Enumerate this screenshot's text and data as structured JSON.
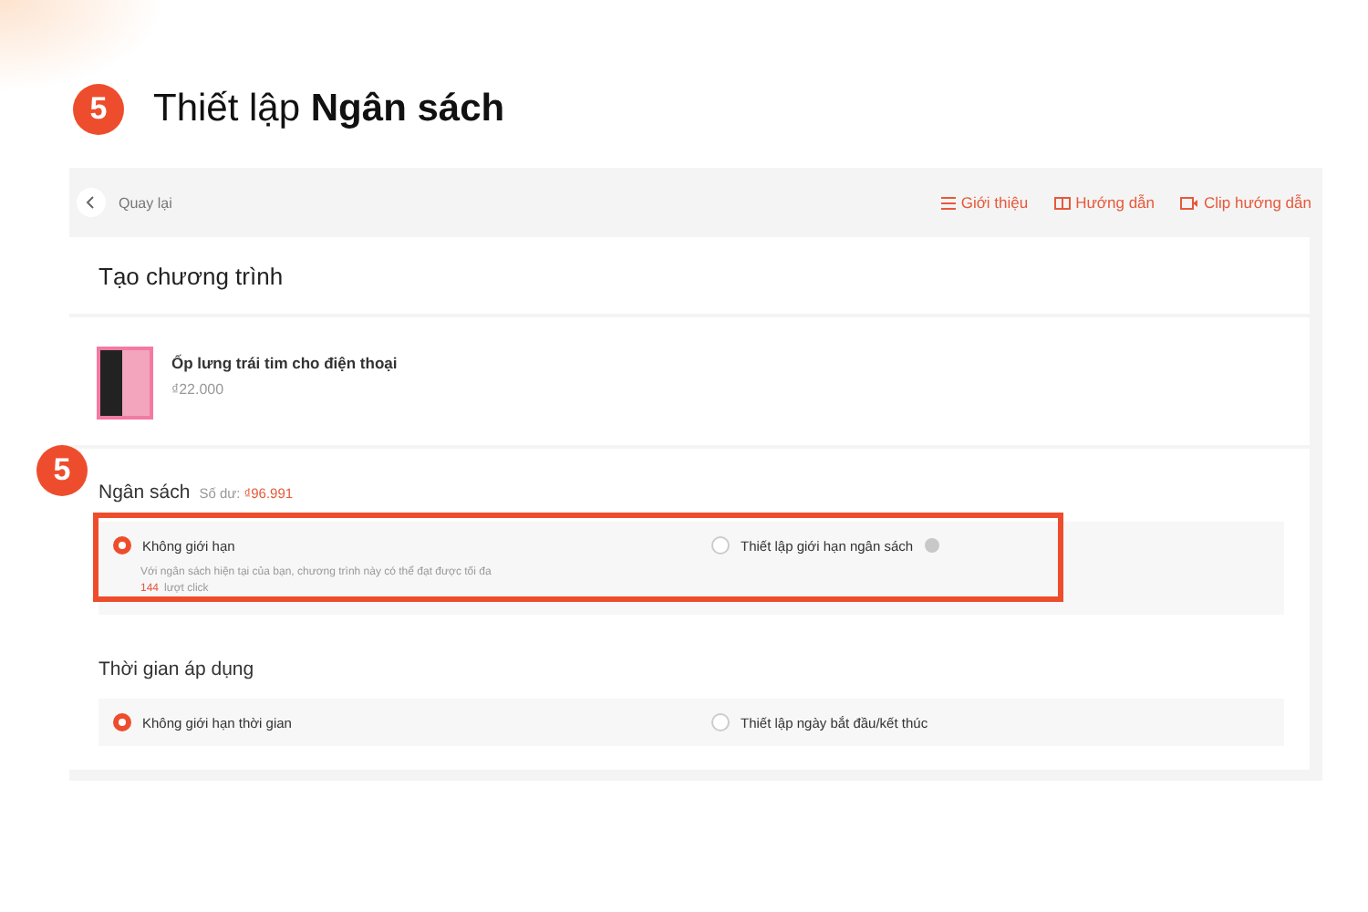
{
  "heading": {
    "step": "5",
    "text": "Thiết lập **Ngân sách**"
  },
  "screen": {
    "back": {
      "label": "Quay lại"
    },
    "links": [
      {
        "kind": "list",
        "label": "Giới thiệu"
      },
      {
        "kind": "book",
        "label": "Hướng dẫn"
      },
      {
        "kind": "video",
        "label": "Clip hướng dẫn"
      }
    ],
    "page_title": "Tạo chương trình",
    "product": {
      "name": "Ốp lưng trái tim cho điện thoại",
      "price": "₫22.000"
    },
    "budget": {
      "step": "5",
      "title": "Ngân sách",
      "balance_label": "Số dư:",
      "balance": "₫96.991",
      "highlighted": true,
      "options": [
        {
          "label": "Không giới hạn",
          "selected": true,
          "help_icon": false,
          "note": "Với ngân sách hiện tại của bạn, chương trình này có thể đạt được tối đa",
          "note_count": "144",
          "note_suffix": "lượt click"
        },
        {
          "label": "Thiết lập giới hạn ngân sách",
          "selected": false,
          "help_icon": true
        }
      ]
    },
    "schedule": {
      "title": "Thời gian áp dụng",
      "options": [
        {
          "label": "Không giới hạn thời gian",
          "selected": true
        },
        {
          "label": "Thiết lập ngày bắt đầu/kết thúc",
          "selected": false
        }
      ]
    }
  }
}
